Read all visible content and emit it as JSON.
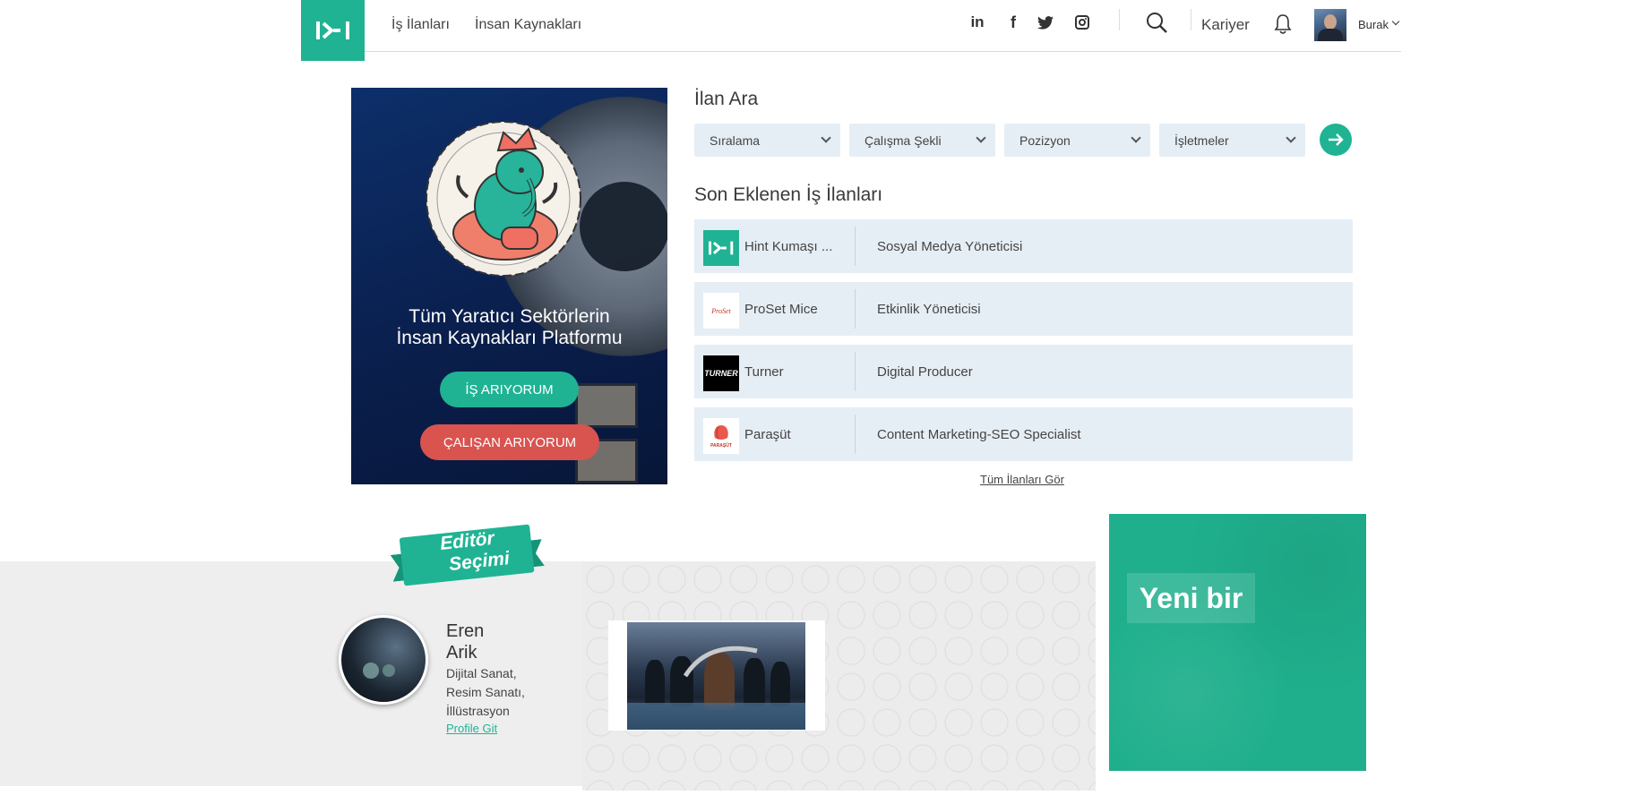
{
  "header": {
    "nav": [
      "İş İlanları",
      "İnsan Kaynakları"
    ],
    "social": [
      "linkedin-icon",
      "facebook-icon",
      "twitter-icon",
      "instagram-icon"
    ],
    "career_label": "Kariyer",
    "user_name": "Burak",
    "accent": "#1fb394"
  },
  "hero": {
    "title_line1": "Tüm Yaratıcı Sektörlerin",
    "title_line2": "İnsan Kaynakları Platformu",
    "btn_job": "İŞ ARIYORUM",
    "btn_employee": "ÇALIŞAN ARIYORUM",
    "btn_job_color": "#1fb394",
    "btn_employee_color": "#d9534f"
  },
  "search": {
    "title": "İlan Ara",
    "dropdowns": [
      "Sıralama",
      "Çalışma Şekli",
      "Pozizyon",
      "İşletmeler"
    ]
  },
  "jobs": {
    "title": "Son Eklenen İş İlanları",
    "items": [
      {
        "company": "Hint Kumaşı ...",
        "position": "Sosyal Medya Yöneticisi"
      },
      {
        "company": "ProSet Mice",
        "position": "Etkinlik Yöneticisi"
      },
      {
        "company": "Turner",
        "position": "Digital Producer"
      },
      {
        "company": "Paraşüt",
        "position": "Content Marketing-SEO Specialist"
      }
    ],
    "all_link": "Tüm İlanları Gör",
    "logo_text": {
      "proset": "ProSet",
      "turner": "TURNER",
      "parasut": "PARAŞÜT"
    }
  },
  "editor": {
    "ribbon_line1": "Editör",
    "ribbon_line2": "Seçimi",
    "name_first": "Eren",
    "name_last": "Arik",
    "tags": [
      "Dijital Sanat,",
      "Resim Sanatı,",
      "İllüstrasyon"
    ],
    "profile_link": "Profile Git"
  },
  "ad": {
    "text": "Yeni bir"
  }
}
